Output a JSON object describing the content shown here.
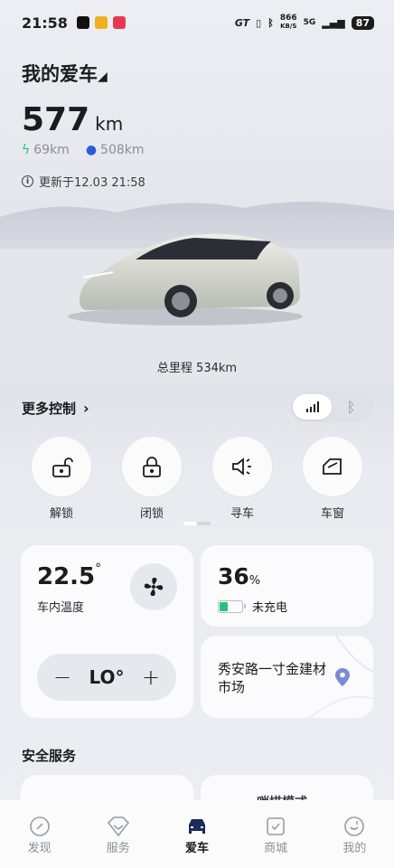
{
  "status": {
    "time": "21:58",
    "carrier_badge": "GT",
    "net_speed_value": "866",
    "net_speed_unit": "KB/S",
    "network": "5G",
    "battery": "87"
  },
  "header": {
    "title": "我的爱车",
    "range_value": "577",
    "range_unit": "km",
    "electric_range": "69km",
    "fuel_range": "508km",
    "updated_text": "更新于12.03 21:58"
  },
  "car": {
    "odometer": "总里程 534km"
  },
  "more_controls": {
    "label": "更多控制",
    "connection": {
      "options": [
        "cellular",
        "bluetooth"
      ],
      "active": "cellular"
    }
  },
  "controls": [
    {
      "name": "unlock",
      "label": "解锁",
      "icon": "unlock-icon"
    },
    {
      "name": "lock",
      "label": "闭锁",
      "icon": "lock-icon"
    },
    {
      "name": "find-car",
      "label": "寻车",
      "icon": "horn-icon"
    },
    {
      "name": "window",
      "label": "车窗",
      "icon": "window-icon"
    }
  ],
  "climate": {
    "temperature": "22.5",
    "degree": "°",
    "label": "车内温度",
    "setting": "LO°",
    "minus": "−",
    "plus": "+"
  },
  "battery": {
    "percent": "36",
    "unit": "%",
    "level": 0.36,
    "status": "未充电",
    "fill_color": "#22c37a"
  },
  "location": {
    "address": "秀安路一寸金建材市场"
  },
  "safety": {
    "title": "安全服务",
    "sentry_label": "哨描模式"
  },
  "tabs": [
    {
      "label": "发现",
      "icon": "compass-icon",
      "active": false
    },
    {
      "label": "服务",
      "icon": "service-icon",
      "active": false
    },
    {
      "label": "爱车",
      "icon": "car-icon",
      "active": true
    },
    {
      "label": "商城",
      "icon": "shop-icon",
      "active": false
    },
    {
      "label": "我的",
      "icon": "profile-icon",
      "active": false
    }
  ]
}
